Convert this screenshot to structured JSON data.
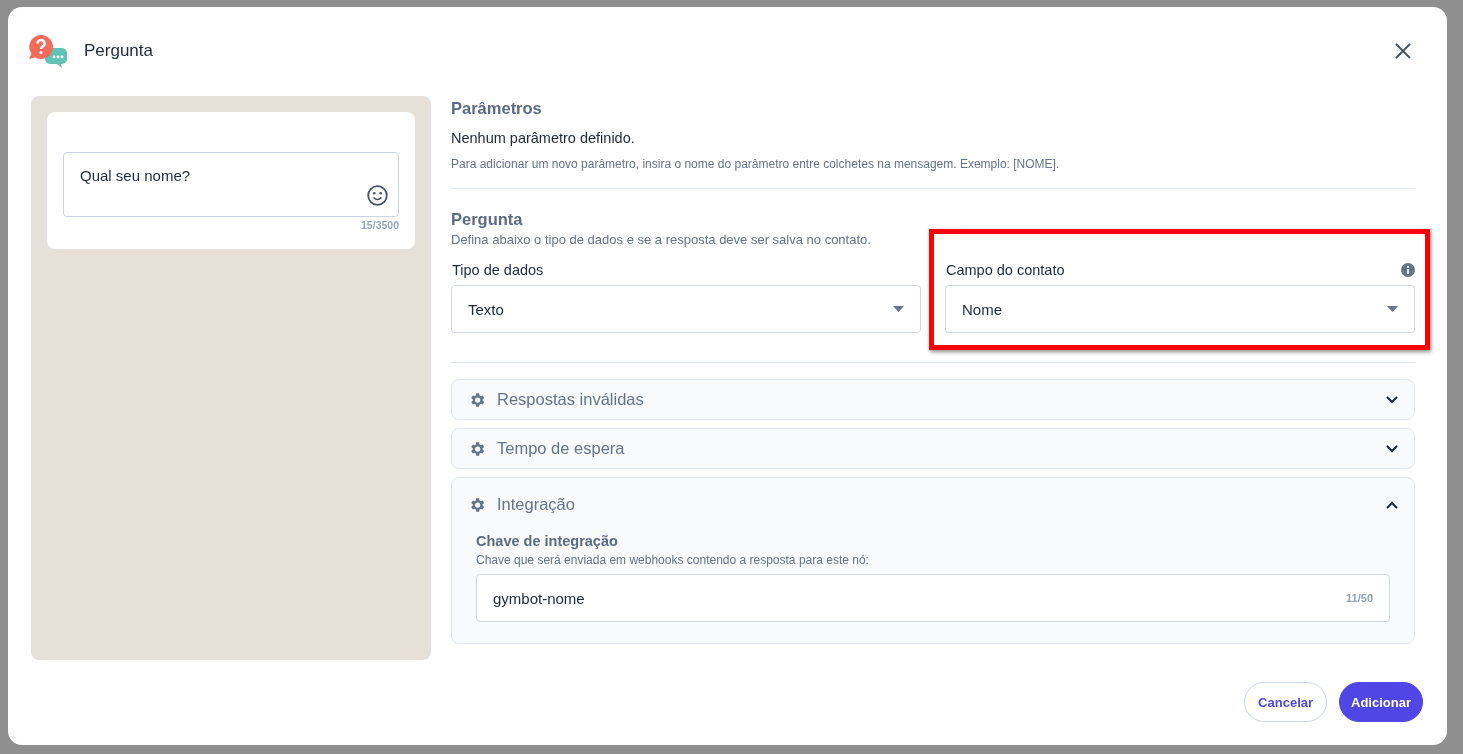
{
  "dialog": {
    "title": "Pergunta"
  },
  "preview": {
    "message": "Qual seu nome?",
    "counter": "15/3500"
  },
  "parameters": {
    "heading": "Parâmetros",
    "status": "Nenhum parâmetro definido.",
    "hint": "Para adicionar um novo parâmetro, insira o nome do parâmetro entre colchetes na mensagem. Exemplo: [NOME]."
  },
  "question": {
    "heading": "Pergunta",
    "description": "Defina abaixo o tipo de dados e se a resposta deve ser salva no contato.",
    "fields": [
      {
        "label": "Tipo de dados",
        "value": "Texto",
        "highlighted": false,
        "info": false
      },
      {
        "label": "Campo do contato",
        "value": "Nome",
        "highlighted": true,
        "info": true
      }
    ]
  },
  "sections": [
    {
      "title": "Respostas inválidas",
      "expanded": false
    },
    {
      "title": "Tempo de espera",
      "expanded": false
    },
    {
      "title": "Integração",
      "expanded": true,
      "content": {
        "label": "Chave de integração",
        "description": "Chave que será enviada em webhooks contendo a resposta para este nó:",
        "value": "gymbot-nome",
        "counter": "11/50"
      }
    }
  ],
  "buttons": [
    {
      "label": "Cancelar",
      "kind": "secondary"
    },
    {
      "label": "Adicionar",
      "kind": "primary"
    }
  ]
}
